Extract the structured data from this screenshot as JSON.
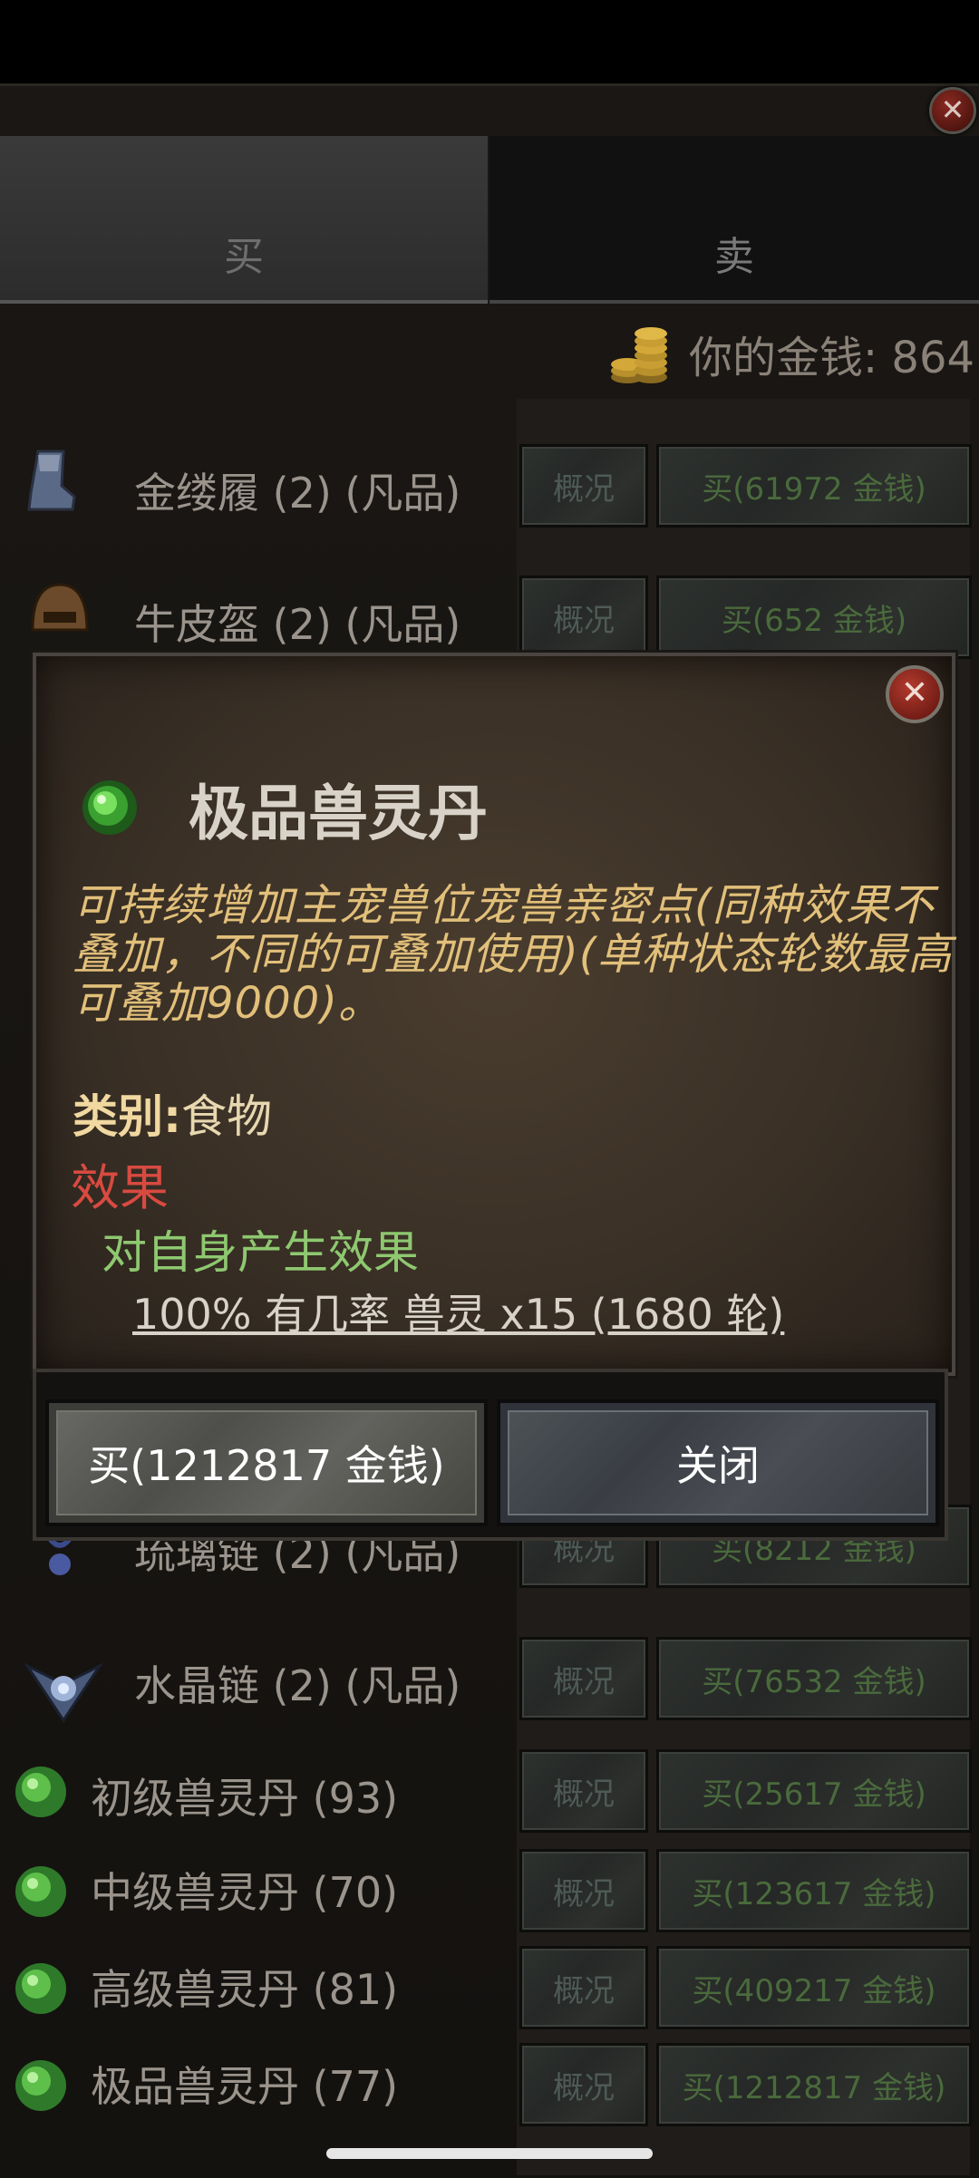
{
  "tabs": {
    "buy": "买",
    "sell": "卖"
  },
  "money": {
    "label": "你的金钱: 864",
    "icon": "gold-coins-icon"
  },
  "common": {
    "info_label": "概况"
  },
  "items": [
    {
      "name": "金缕履 (2) (凡品)",
      "price": "买(61972 金钱)",
      "icon": "boots-icon"
    },
    {
      "name": "牛皮盔 (2) (凡品)",
      "price": "买(652 金钱)",
      "icon": "helmet-icon"
    },
    {
      "name": "琉璃链 (2) (凡品)",
      "price": "买(8212 金钱)",
      "icon": "necklace-icon"
    },
    {
      "name": "水晶链 (2) (凡品)",
      "price": "买(76532 金钱)",
      "icon": "crystal-necklace-icon"
    },
    {
      "name": "初级兽灵丹 (93)",
      "price": "买(25617 金钱)",
      "icon": "green-pill-icon"
    },
    {
      "name": "中级兽灵丹 (70)",
      "price": "买(123617 金钱)",
      "icon": "green-pill-icon"
    },
    {
      "name": "高级兽灵丹 (81)",
      "price": "买(409217 金钱)",
      "icon": "green-pill-icon"
    },
    {
      "name": "极品兽灵丹 (77)",
      "price": "买(1212817 金钱)",
      "icon": "green-pill-icon"
    }
  ],
  "dialog": {
    "title": "极品兽灵丹",
    "description": "可持续增加主宠兽位宠兽亲密点(同种效果不叠加，不同的可叠加使用)(单种状态轮数最高可叠加9000)。",
    "category_label": "类别:",
    "category_value": "食物",
    "effect_heading": "效果",
    "effect_target": "对自身产生效果",
    "effect_line": "100% 有几率 兽灵 x15 (1680 轮)",
    "buy_button": "买(1212817 金钱)",
    "close_button": "关闭"
  },
  "colors": {
    "description": "#e2c07a",
    "effect_heading": "#d84a40",
    "effect_target": "#8ec870",
    "buy_price_text": "#4a6a3c"
  }
}
